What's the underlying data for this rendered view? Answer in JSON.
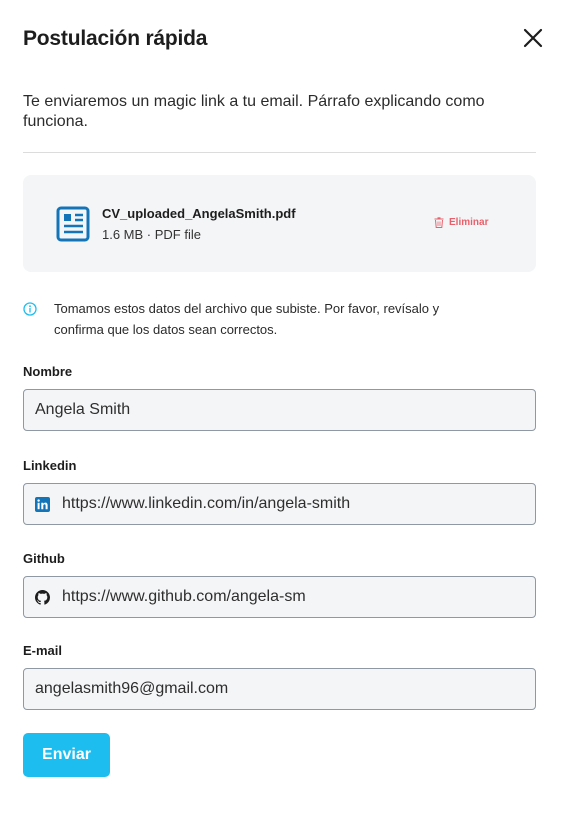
{
  "dialog": {
    "title": "Postulación rápida",
    "close_icon": "close-icon"
  },
  "intro": "Te enviaremos un magic link a tu email. Párrafo explicando como funciona.",
  "file": {
    "icon": "document-icon",
    "name": "CV_uploaded_AngelaSmith.pdf",
    "meta": "1.6 MB · PDF file",
    "remove_label": "Eliminar",
    "remove_icon": "trash-icon"
  },
  "info": {
    "icon": "info-icon",
    "text": "Tomamos estos datos del archivo que subiste. Por favor, revísalo y confirma que los datos sean correctos."
  },
  "fields": {
    "name": {
      "label": "Nombre",
      "value": "Angela Smith"
    },
    "linkedin": {
      "label": "Linkedin",
      "value": "https://www.linkedin.com/in/angela-smith",
      "icon": "linkedin-icon"
    },
    "github": {
      "label": "Github",
      "value": "https://www.github.com/angela-sm",
      "icon": "github-icon"
    },
    "email": {
      "label": "E-mail",
      "value": "angelasmith96@gmail.com"
    }
  },
  "submit_label": "Enviar",
  "colors": {
    "accent": "#1ebdf0",
    "danger": "#e8606b",
    "card_bg": "#f4f5f7",
    "icon_blue": "#1474b8"
  }
}
